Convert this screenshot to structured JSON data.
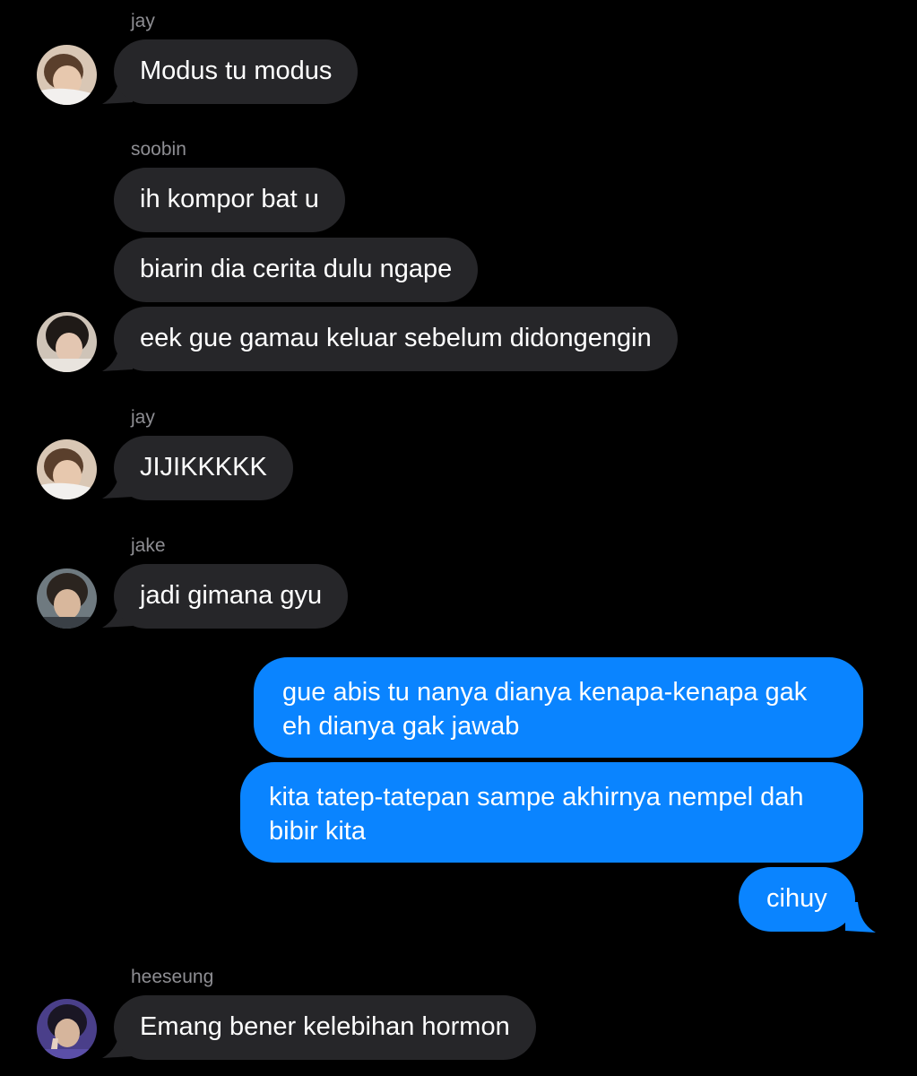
{
  "conversation": {
    "theme": {
      "background": "#000000",
      "incoming_bubble": "#262629",
      "outgoing_bubble": "#0a84ff",
      "sender_name_color": "#8e8e93"
    },
    "groups": [
      {
        "sender": "jay",
        "avatar": "jay-avatar",
        "messages": [
          "Modus tu modus"
        ]
      },
      {
        "sender": "soobin",
        "avatar": "soobin-avatar",
        "messages": [
          "ih kompor bat u",
          "biarin dia cerita dulu ngape",
          "eek gue gamau keluar sebelum didongengin"
        ]
      },
      {
        "sender": "jay",
        "avatar": "jay-avatar",
        "messages": [
          "JIJIKKKKK"
        ]
      },
      {
        "sender": "jake",
        "avatar": "jake-avatar",
        "messages": [
          "jadi gimana gyu"
        ]
      },
      {
        "sender": "me",
        "outgoing": true,
        "messages": [
          "gue abis tu nanya dianya kenapa-kenapa gak eh dianya gak jawab",
          "kita tatep-tatepan sampe akhirnya nempel dah bibir kita",
          "cihuy"
        ]
      },
      {
        "sender": "heeseung",
        "avatar": "heeseung-avatar",
        "messages": [
          "Emang bener kelebihan hormon"
        ]
      }
    ]
  }
}
